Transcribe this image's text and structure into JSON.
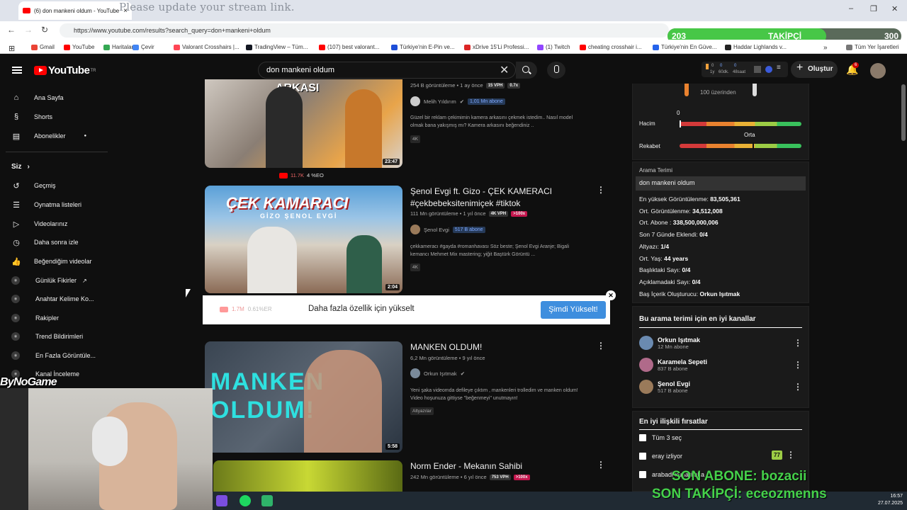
{
  "browser": {
    "tab_title": "(6) don mankeni oldum - YouTube",
    "stream_note": "Please update your stream link.",
    "url": "https://www.youtube.com/results?search_query=don+mankeni+oldum",
    "bookmarks": [
      {
        "label": "Gmail",
        "color": "#ea4335"
      },
      {
        "label": "YouTube",
        "color": "#ff0000"
      },
      {
        "label": "Haritalar",
        "color": "#34a853"
      },
      {
        "label": "Çevir",
        "color": "#4285f4"
      },
      {
        "label": "Valorant Crosshairs |...",
        "color": "#ff4655"
      },
      {
        "label": "TradingView – Tüm...",
        "color": "#131722"
      },
      {
        "label": "(107) best valorant...",
        "color": "#ff0000"
      },
      {
        "label": "Türkiye'nin E-Pin ve...",
        "color": "#1d4ed8"
      },
      {
        "label": "xDrive 15'Li Professi...",
        "color": "#dc2626"
      },
      {
        "label": "(1) Twitch",
        "color": "#9146ff"
      },
      {
        "label": "cheating crosshair i...",
        "color": "#ff0000"
      },
      {
        "label": "Türkiye'nin En Güve...",
        "color": "#2563eb"
      },
      {
        "label": "Haddar Lighlands v...",
        "color": "#222222"
      }
    ],
    "all_bookmarks": "Tüm Yer İşaretleri"
  },
  "takipci": {
    "current": "203",
    "label": "TAKİPÇİ",
    "goal": "300",
    "progress": 0.68
  },
  "youtube": {
    "logo": "YouTube",
    "logo_region": "TR",
    "search_query": "don mankeni oldum",
    "create_label": "Oluştur",
    "notification_count": "6",
    "mini_stats": [
      "0",
      "0",
      "0",
      "1y",
      "60dk.",
      "48saat"
    ]
  },
  "sidebar": {
    "main": [
      "Ana Sayfa",
      "Shorts",
      "Abonelikler"
    ],
    "you_header": "Siz",
    "you_items": [
      "Geçmiş",
      "Oynatma listeleri",
      "Videolarınız",
      "Daha sonra izle",
      "Beğendiğim videolar"
    ],
    "tools": [
      "Günlük Fikirler",
      "Anahtar Kelime Ko...",
      "Rakipler",
      "Trend Bildirimleri",
      "En Fazla Görüntüle...",
      "Kanal İnceleme"
    ]
  },
  "results": [
    {
      "meta": "254 B görüntüleme • 1 ay önce",
      "tag1": "15 VPH",
      "tag2": "0.7x",
      "channel": "Melih Yıldırım",
      "subs": "1,01 Mn abone",
      "desc1": "Güzel bir reklam çekimimin kamera arkasını çekmek istedim.. Nasıl model",
      "desc2": "olmak bana yakışmış mı? Kamera arkasını beğendiniz ..",
      "badge": "4K",
      "duration": "23:47",
      "likes": "11.7K",
      "eo": "4 %EO",
      "thumb_text": "ARKASI"
    },
    {
      "title1": "Şenol Evgi ft. Gizo - ÇEK KAMERACI",
      "title2": "#çekbebeksitenimiçek #tiktok",
      "meta": "111 Mn görüntüleme • 1 yıl önce",
      "tag1": "4K VPH",
      "tag2": ">100x",
      "channel": "Şenol Evgi",
      "subs": "517 B abone",
      "desc1": "çekkameracı #gayda #romanhavası Söz beste; Şenol Evgi Aranje; Bigali",
      "desc2": "kemancı Mehmet Mix mastering; yiğit Baştürk Görüntü ...",
      "badge": "4K",
      "duration": "2:04",
      "thumb_text": "ÇEK KAMARACI",
      "thumb_sub": "GİZO ŞENOL EVGİ"
    },
    {
      "title1": "MANKEN OLDUM!",
      "meta": "6,2 Mn görüntüleme • 9 yıl önce",
      "channel": "Orkun Işıtmak",
      "desc1": "Yeni şaka videomda defileye çıktım , mankenleri trolledim ve manken oldum!",
      "desc2": "Video hoşunuza gittiyse \"beğenmeyi\" unutmayın!",
      "badge": "Altyazılar",
      "duration": "5:58",
      "thumb_text1": "MANKEN",
      "thumb_text2": "OLDUM!"
    },
    {
      "title1": "Norm Ender - Mekanın Sahibi",
      "meta": "242 Mn görüntüleme • 6 yıl önce",
      "tag1": "753 VPH",
      "tag2": ">100x"
    }
  ],
  "upgrade": {
    "text": "Daha fazla özellik için yükselt",
    "button": "Şimdi Yükselt!",
    "stat1": "1.7M",
    "stat2": "0.61%ER"
  },
  "panel": {
    "over100": "100 üzerinden",
    "volume_label": "Hacim",
    "volume_value": "0",
    "volume_level": 0.0,
    "competition_label": "Rekabet",
    "competition_value": "Orta",
    "competition_level": 0.6,
    "search_term_header": "Arama Terimi",
    "search_term": "don mankeni oldum",
    "stats": [
      {
        "k": "En yüksek Görüntülenme:",
        "v": "83,505,361"
      },
      {
        "k": "Ort. Görüntülenme:",
        "v": "34,512,008"
      },
      {
        "k": "Ort. Abone :",
        "v": "338,500,000,006"
      },
      {
        "k": "Son 7 Günde Eklendi:",
        "v": "0/4"
      },
      {
        "k": "Altyazı:",
        "v": "1/4"
      },
      {
        "k": "Ort. Yaş:",
        "v": "44 years"
      },
      {
        "k": "Başlıktaki Sayı:",
        "v": "0/4"
      },
      {
        "k": "Açıklamadaki Sayı:",
        "v": "0/4"
      },
      {
        "k": "Baş İçerik Oluşturucu:",
        "v": "Orkun Işıtmak"
      }
    ],
    "top_channels_header": "Bu arama terimi için en iyi kanallar",
    "top_channels": [
      {
        "name": "Orkun Işıtmak",
        "subs": "12 Mn abone"
      },
      {
        "name": "Karamela Sepeti",
        "subs": "837 B abone"
      },
      {
        "name": "Şenol Evgi",
        "subs": "517 B abone"
      }
    ],
    "opps_header": "En iyi ilişkili fırsatlar",
    "opps": [
      {
        "label": "Tüm 3 seç"
      },
      {
        "label": "eray izliyor",
        "score": "77"
      },
      {
        "label": "arabadi kurlari aka"
      }
    ]
  },
  "overlay": {
    "brand": "ByNoGame",
    "son_abone": "SON ABONE: bozacii",
    "son_takipci": "SON TAKİPÇİ: eceozmenns",
    "time": "16:57",
    "date": "27.07.2025"
  }
}
